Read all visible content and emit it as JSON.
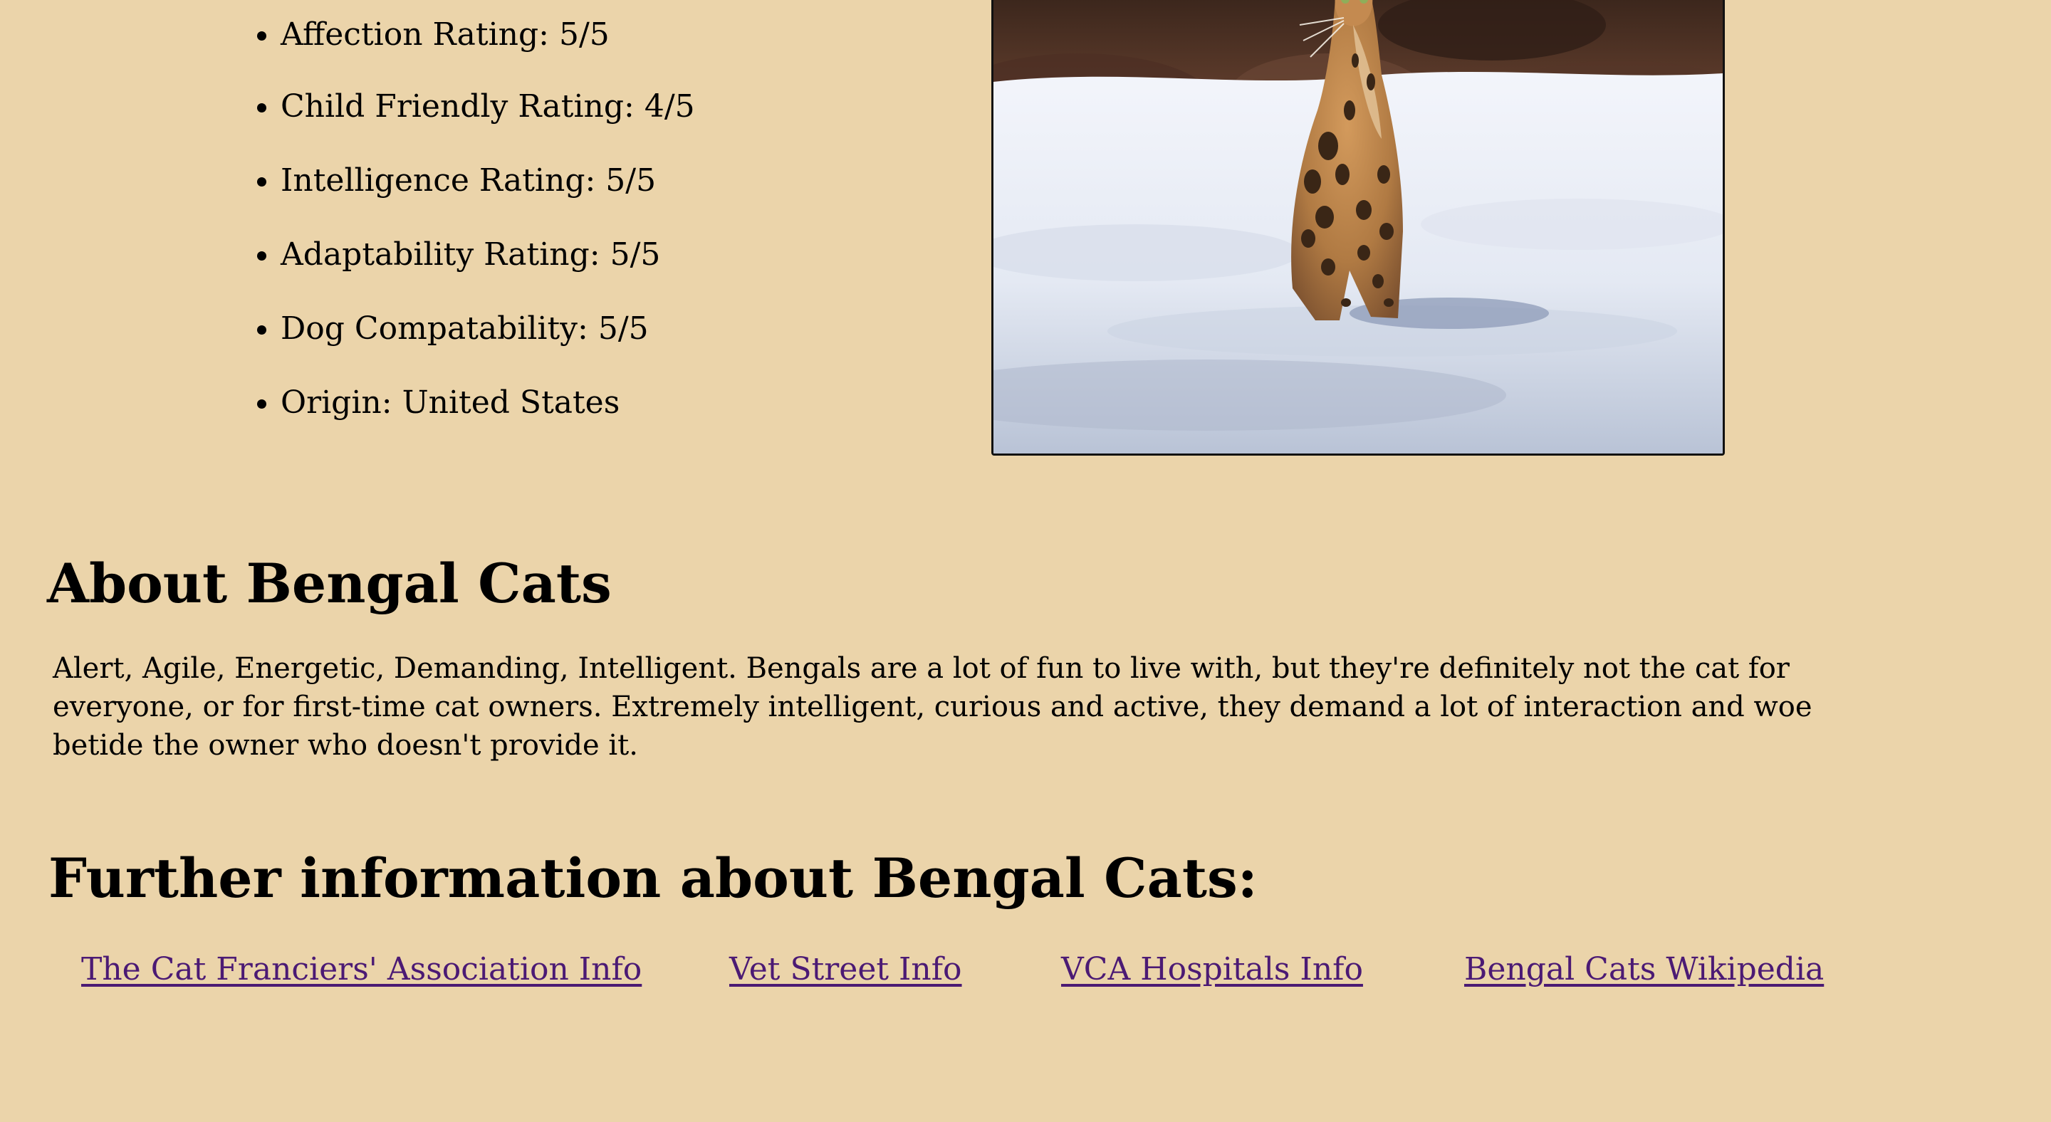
{
  "breed_facts": [
    "Affection Rating: 5/5",
    "Child Friendly Rating: 4/5",
    "Intelligence Rating: 5/5",
    "Adaptability Rating: 5/5",
    "Dog Compatability: 5/5",
    "Origin: United States"
  ],
  "photo": {
    "subject": "bengal-cat-in-snow",
    "colors": {
      "background": "#ebd4aa",
      "snow": "#e9edf5",
      "fur": "#b07a43",
      "spots": "#3a2616",
      "trees": "#4a3124",
      "link": "#4b1a74"
    }
  },
  "about": {
    "heading": "About Bengal Cats",
    "text": "Alert, Agile, Energetic, Demanding, Intelligent. Bengals are a lot of fun to live with, but they're definitely not the cat for everyone, or for first-time cat owners. Extremely intelligent, curious and active, they demand a lot of interaction and woe betide the owner who doesn't provide it."
  },
  "further": {
    "heading": "Further information about Bengal Cats:",
    "links": [
      "The Cat Franciers' Association Info",
      "Vet Street Info",
      "VCA Hospitals Info",
      "Bengal Cats Wikipedia"
    ]
  }
}
